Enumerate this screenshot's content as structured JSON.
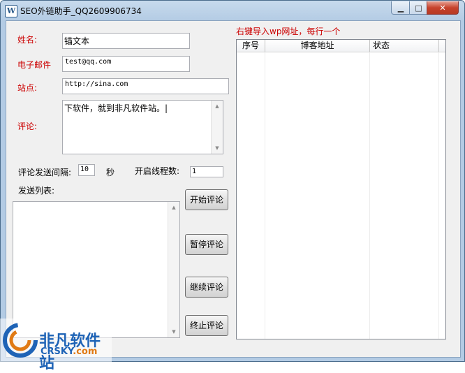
{
  "window": {
    "title": "SEO外链助手_QQ2609906734",
    "icon": "wordpress-icon",
    "controls": {
      "minimize": "minimize-icon",
      "maximize": "maximize-icon",
      "close": "close-icon"
    }
  },
  "form": {
    "name_label": "姓名:",
    "name_value": "锚文本",
    "email_label": "电子邮件",
    "email_value": "test@qq.com",
    "site_label": "站点:",
    "site_value": "http://sina.com",
    "comment_label": "评论:",
    "comment_value": "下软件，就到非凡软件站。|"
  },
  "settings": {
    "interval_label": "评论发送间隔:",
    "interval_value": "10",
    "interval_unit": "秒",
    "threads_label": "开启线程数:",
    "threads_value": "1"
  },
  "send_list": {
    "label": "发送列表:"
  },
  "buttons": {
    "start": "开始评论",
    "pause": "暂停评论",
    "resume": "继续评论",
    "stop": "终止评论"
  },
  "import_hint": "右键导入wp网址，每行一个",
  "table": {
    "columns": [
      "序号",
      "博客地址",
      "状态"
    ]
  },
  "watermark": {
    "name": "非凡软件站",
    "url_main": "CRSKY",
    "url_tld": ".com"
  },
  "colors": {
    "label_red": "#cc0000",
    "watermark_blue": "#1e63b6"
  }
}
